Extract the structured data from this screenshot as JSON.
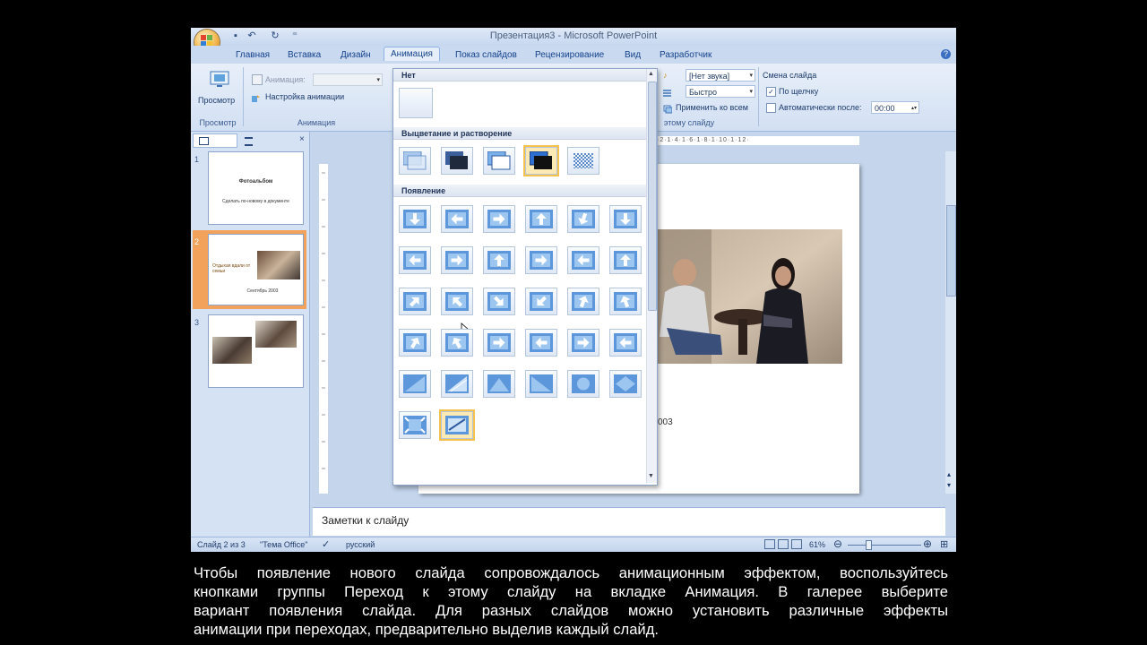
{
  "window": {
    "title": "Презентация3 - Microsoft PowerPoint"
  },
  "tabs": [
    "Главная",
    "Вставка",
    "Дизайн",
    "Анимация",
    "Показ слайдов",
    "Рецензирование",
    "Вид",
    "Разработчик"
  ],
  "active_tab": "Анимация",
  "ribbon": {
    "preview_label": "Просмотр",
    "preview_group": "Просмотр",
    "animation_label": "Анимация:",
    "custom_animation": "Настройка анимации",
    "animation_group": "Анимация",
    "sound_value": "[Нет звука]",
    "speed_value": "Быстро",
    "apply_all": "Применить ко всем",
    "transition_group": "этому слайду",
    "advance_title": "Смена слайда",
    "on_click": "По щелчку",
    "auto_after": "Автоматически после:",
    "auto_time": "00:00"
  },
  "gallery": {
    "sections": [
      "Нет",
      "Выцветание и растворение",
      "Появление"
    ]
  },
  "slides": {
    "s1_title": "Фотоальбом",
    "s1_sub": "Сделать по-новому в документе",
    "s2_title": "Отдыхая вдали от семьи",
    "s2_year": "Сентябрь 2003",
    "nums": [
      "1",
      "2",
      "3"
    ]
  },
  "slide_year_fragment": "003",
  "notes_placeholder": "Заметки к слайду",
  "status": {
    "slide_info": "Слайд 2 из 3",
    "theme": "\"Тема Office\"",
    "language": "русский",
    "zoom": "61%"
  },
  "caption": [
    "Чтобы появление нового слайда сопровождалось анимационным эффектом, воспользуйтесь",
    "кнопками группы Переход к этому слайду  на вкладке  Анимация.  В  галерее  выберите",
    "вариант появления слайда. Для разных слайдов можно  установить  различные  эффекты",
    "анимации при переходах, предварительно выделив каждый слайд."
  ]
}
